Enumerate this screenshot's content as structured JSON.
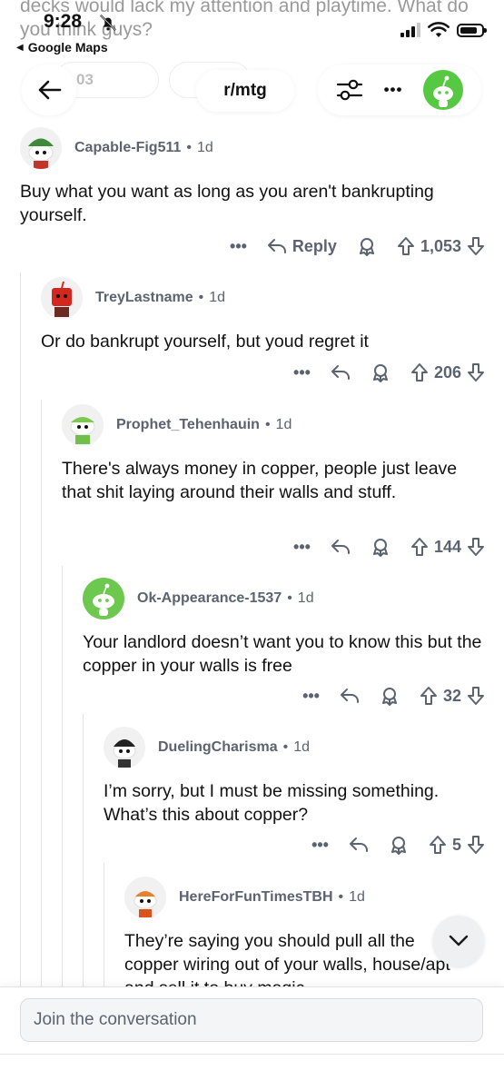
{
  "background_post_text": "decks would lack my attention and playtime. What do you think guys?",
  "status_bar": {
    "time": "9:28",
    "back_app": "Google Maps"
  },
  "nav": {
    "subreddit": "r/mtg",
    "ghost_vote_count": "03",
    "more_label": "•••"
  },
  "comments": [
    {
      "author": "Capable-Fig511",
      "time": "1d",
      "body": "Buy what you want as long as you aren't bankrupting yourself.",
      "reply_label": "Reply",
      "votes": "1,053",
      "more": "•••",
      "avatar_color": "#f2f2f2"
    },
    {
      "author": "TreyLastname",
      "time": "1d",
      "body": "Or do bankrupt yourself, but youd regret it",
      "votes": "206",
      "more": "•••",
      "avatar_color": "#f2f2f2"
    },
    {
      "author": "Prophet_Tehenhauin",
      "time": "1d",
      "body": "There's always money in copper, people just leave that shit laying around their walls and stuff.",
      "votes": "144",
      "more": "•••",
      "avatar_color": "#f2f2f2"
    },
    {
      "author": "Ok-Appearance-1537",
      "time": "1d",
      "body": "Your landlord doesn’t want you to know this but the copper in your walls is free",
      "votes": "32",
      "more": "•••",
      "avatar_color": "#6cc84f"
    },
    {
      "author": "DuelingCharisma",
      "time": "1d",
      "body": "I’m sorry, but I must be missing something. What’s this about copper?",
      "votes": "5",
      "more": "•••",
      "avatar_color": "#f2f2f2"
    },
    {
      "author": "HereForFunTimesTBH",
      "time": "1d",
      "body": "They’re saying you should pull all the copper wiring out of your walls, house/apt and sell it to buy magic",
      "avatar_color": "#f2f2f2"
    }
  ],
  "bottom": {
    "join_placeholder": "Join the conversation"
  },
  "colors": {
    "meta_gray": "#5c6370",
    "thread_line": "#e3e3e3",
    "reddit_green": "#57c842"
  }
}
